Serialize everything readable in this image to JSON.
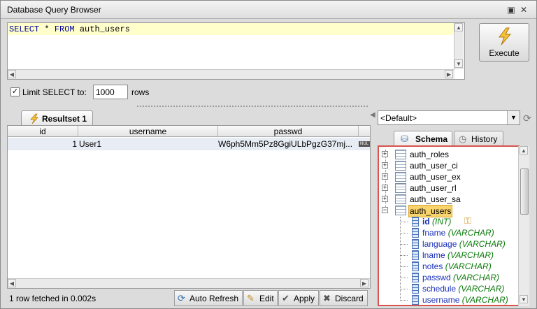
{
  "window": {
    "title": "Database Query Browser"
  },
  "query": {
    "text": "SELECT * FROM auth_users",
    "keyword1": "SELECT",
    "rest1": " * ",
    "keyword2": "FROM",
    "rest2": " auth_users"
  },
  "execute": {
    "label": "Execute"
  },
  "limit": {
    "label": "Limit SELECT to:",
    "checked": true,
    "value": "1000",
    "suffix": "rows"
  },
  "resultset": {
    "tab_label": "Resultset 1",
    "columns": [
      "id",
      "username",
      "passwd"
    ],
    "rows": [
      {
        "id": "1",
        "username": "User1",
        "passwd": "W6ph5Mm5Pz8GgiULbPgzG37mj...",
        "nul_badge": "NUL"
      }
    ],
    "status": "1 row fetched in 0.002s"
  },
  "actions": {
    "auto_refresh": "Auto Refresh",
    "edit": "Edit",
    "apply": "Apply",
    "discard": "Discard"
  },
  "datasource": {
    "selected": "<Default>"
  },
  "tabs": {
    "schema": "Schema",
    "history": "History"
  },
  "schema_tree": {
    "tables": [
      "auth_roles",
      "auth_user_ci",
      "auth_user_ex",
      "auth_user_rl",
      "auth_user_sa",
      "auth_users"
    ],
    "selected_table": "auth_users",
    "columns": [
      {
        "name": "id",
        "type": "(INT)"
      },
      {
        "name": "fname",
        "type": "(VARCHAR)"
      },
      {
        "name": "language",
        "type": "(VARCHAR)"
      },
      {
        "name": "lname",
        "type": "(VARCHAR)"
      },
      {
        "name": "notes",
        "type": "(VARCHAR)"
      },
      {
        "name": "passwd",
        "type": "(VARCHAR)"
      },
      {
        "name": "schedule",
        "type": "(VARCHAR)"
      },
      {
        "name": "username",
        "type": "(VARCHAR)"
      }
    ]
  },
  "colors": {
    "highlight_border": "#d9534f",
    "selection": "#f9d36b",
    "keyword": "#000099",
    "column_type": "#0a7a0a"
  }
}
